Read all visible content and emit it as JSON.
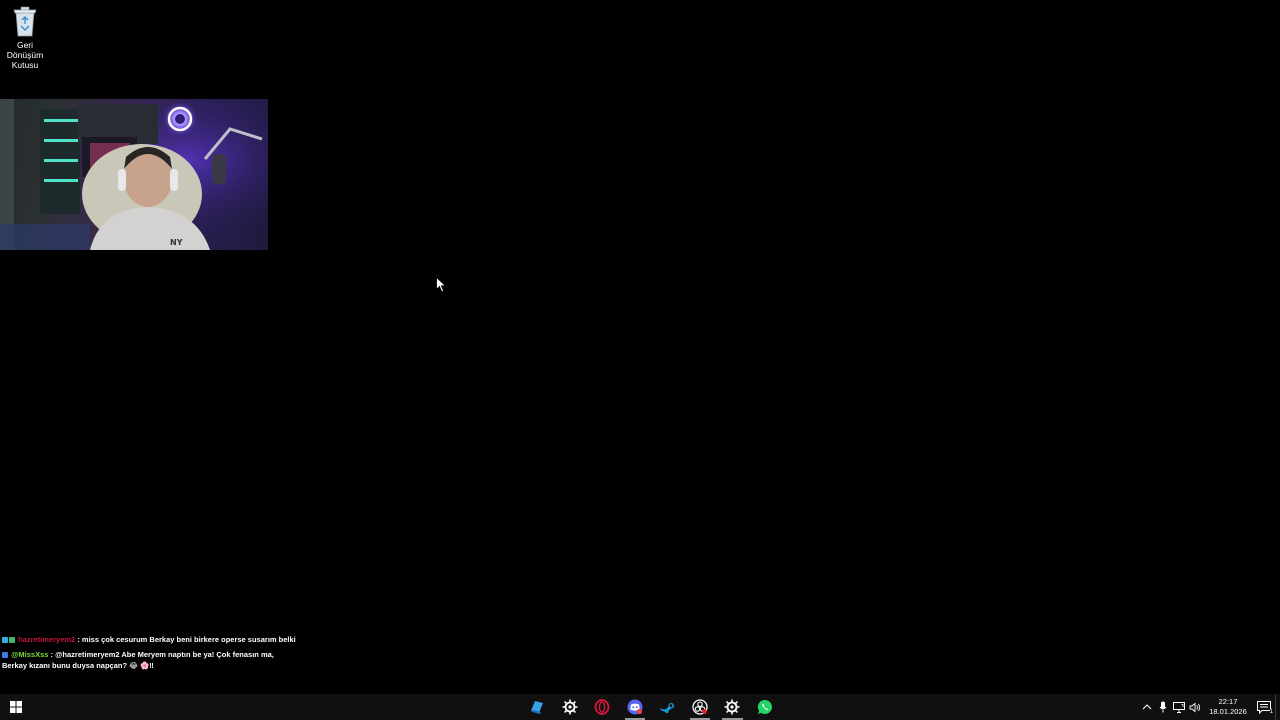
{
  "desktop": {
    "background_color": "#000000",
    "icons": [
      {
        "label_lines": [
          "Geri",
          "Dönüşüm",
          "Kutusu"
        ],
        "icon": "recycle-bin-icon"
      }
    ]
  },
  "webcam": {
    "content": "webcam-video-feed"
  },
  "chat": {
    "messages": [
      {
        "user": "hazretimeryem2",
        "text": ": miss çok cesurum Berkay beni birkere operse susarım belki",
        "user_color": "#c0143c"
      },
      {
        "user": "@MissXss",
        "text_line1": ": @hazretimeryem2 Abe Meryem naptın be ya! Çok fenasın ma,",
        "text_line2": "Berkay kızanı bunu duysa napçan? 😂 🌸‼",
        "user_color": "#7cdc3c"
      }
    ]
  },
  "taskbar": {
    "start_icon": "windows-logo-icon",
    "apps": [
      {
        "icon": "files-app-icon",
        "running": false
      },
      {
        "icon": "steelseries-gg-icon",
        "running": false
      },
      {
        "icon": "opera-gx-icon",
        "running": false
      },
      {
        "icon": "discord-icon",
        "running": true
      },
      {
        "icon": "steam-icon",
        "running": false
      },
      {
        "icon": "obs-icon",
        "running": true
      },
      {
        "icon": "steelseries-engine-icon",
        "running": true
      },
      {
        "icon": "whatsapp-icon",
        "running": false
      }
    ],
    "tray": {
      "icons": [
        "chevron-up-icon",
        "microphone-icon",
        "network-icon",
        "volume-icon"
      ],
      "time": "22:17",
      "date": "18.01.2026",
      "notification_count": "1"
    }
  }
}
